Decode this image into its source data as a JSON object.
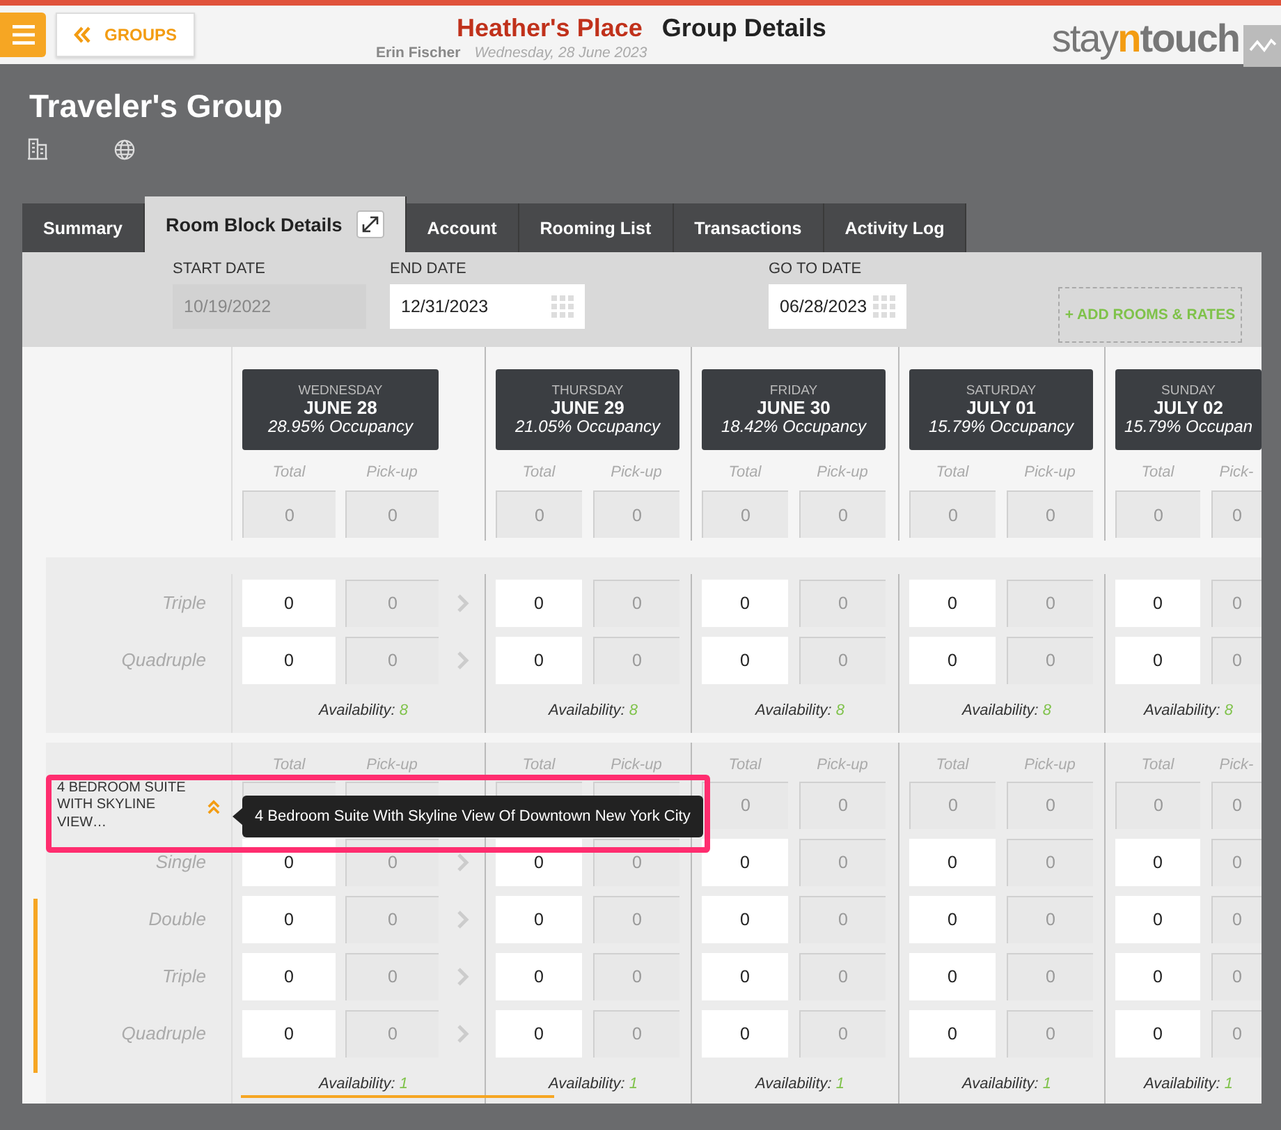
{
  "header": {
    "back_button": "GROUPS",
    "property": "Heather's Place",
    "page_title": "Group Details",
    "user": "Erin Fischer",
    "date": "Wednesday, 28 June 2023",
    "logo": [
      "stay",
      "n",
      "touch"
    ]
  },
  "group": {
    "title": "Traveler's Group"
  },
  "tabs": [
    {
      "label": "Summary",
      "selected": false
    },
    {
      "label": "Room Block Details",
      "selected": true
    },
    {
      "label": "Account",
      "selected": false
    },
    {
      "label": "Rooming List",
      "selected": false
    },
    {
      "label": "Transactions",
      "selected": false
    },
    {
      "label": "Activity Log",
      "selected": false
    }
  ],
  "dates": [
    {
      "label": "START DATE",
      "value": "10/19/2022",
      "disabled": true
    },
    {
      "label": "END DATE",
      "value": "12/31/2023",
      "disabled": false
    },
    {
      "label": "GO TO DATE",
      "value": "06/28/2023",
      "disabled": false
    }
  ],
  "add_button": "+ ADD ROOMS & RATES",
  "days": [
    {
      "weekday": "WEDNESDAY",
      "date": "JUNE 28",
      "occupancy": "28.95% Occupancy"
    },
    {
      "weekday": "THURSDAY",
      "date": "JUNE 29",
      "occupancy": "21.05% Occupancy"
    },
    {
      "weekday": "FRIDAY",
      "date": "JUNE 30",
      "occupancy": "18.42% Occupancy"
    },
    {
      "weekday": "SATURDAY",
      "date": "JULY 01",
      "occupancy": "15.79% Occupancy"
    },
    {
      "weekday": "SUNDAY",
      "date": "JULY 02",
      "occupancy": "15.79% Occupan"
    }
  ],
  "top_fields": [
    {
      "total_label": "Total",
      "pickup_label": "Pick-up",
      "total": "0",
      "pickup": "0"
    },
    {
      "total_label": "Total",
      "pickup_label": "Pick-up",
      "total": "0",
      "pickup": "0"
    },
    {
      "total_label": "Total",
      "pickup_label": "Pick-up",
      "total": "0",
      "pickup": "0"
    },
    {
      "total_label": "Total",
      "pickup_label": "Pick-up",
      "total": "0",
      "pickup": "0"
    },
    {
      "total_label": "Total",
      "pickup_label": "Pick-",
      "total": "0",
      "pickup": "0"
    }
  ],
  "room_types": [
    {
      "rows": [
        {
          "label": "Triple",
          "cells": [
            {
              "total": "0",
              "pickup": "0"
            },
            {
              "total": "0",
              "pickup": "0"
            },
            {
              "total": "0",
              "pickup": "0"
            },
            {
              "total": "0",
              "pickup": "0"
            },
            {
              "total": "0",
              "pickup": "0"
            }
          ]
        },
        {
          "label": "Quadruple",
          "cells": [
            {
              "total": "0",
              "pickup": "0"
            },
            {
              "total": "0",
              "pickup": "0"
            },
            {
              "total": "0",
              "pickup": "0"
            },
            {
              "total": "0",
              "pickup": "0"
            },
            {
              "total": "0",
              "pickup": "0"
            }
          ]
        }
      ],
      "availability": [
        {
          "label": "Availability:",
          "value": "8"
        },
        {
          "label": "Availability:",
          "value": "8"
        },
        {
          "label": "Availability:",
          "value": "8"
        },
        {
          "label": "Availability:",
          "value": "8"
        },
        {
          "label": "Availability:",
          "value": "8"
        }
      ]
    },
    {
      "name": "4 BEDROOM SUITE WITH SKYLINE VIEW…",
      "tooltip": "4 Bedroom Suite With Skyline View Of Downtown New York City",
      "column_labels": [
        {
          "total": "Total",
          "pickup": "Pick-up"
        },
        {
          "total": "Total",
          "pickup": "Pick-up"
        },
        {
          "total": "Total",
          "pickup": "Pick-up"
        },
        {
          "total": "Total",
          "pickup": "Pick-up"
        },
        {
          "total": "Total",
          "pickup": "Pick-"
        }
      ],
      "name_cells": [
        {},
        {},
        {
          "total": "0",
          "pickup": "0"
        },
        {
          "total": "0",
          "pickup": "0"
        },
        {
          "total": "0",
          "pickup": "0"
        }
      ],
      "rows": [
        {
          "label": "Single",
          "cells": [
            {
              "total": "0",
              "pickup": "0"
            },
            {
              "total": "0",
              "pickup": "0"
            },
            {
              "total": "0",
              "pickup": "0"
            },
            {
              "total": "0",
              "pickup": "0"
            },
            {
              "total": "0",
              "pickup": "0"
            }
          ]
        },
        {
          "label": "Double",
          "cells": [
            {
              "total": "0",
              "pickup": "0"
            },
            {
              "total": "0",
              "pickup": "0"
            },
            {
              "total": "0",
              "pickup": "0"
            },
            {
              "total": "0",
              "pickup": "0"
            },
            {
              "total": "0",
              "pickup": "0"
            }
          ]
        },
        {
          "label": "Triple",
          "cells": [
            {
              "total": "0",
              "pickup": "0"
            },
            {
              "total": "0",
              "pickup": "0"
            },
            {
              "total": "0",
              "pickup": "0"
            },
            {
              "total": "0",
              "pickup": "0"
            },
            {
              "total": "0",
              "pickup": "0"
            }
          ]
        },
        {
          "label": "Quadruple",
          "cells": [
            {
              "total": "0",
              "pickup": "0"
            },
            {
              "total": "0",
              "pickup": "0"
            },
            {
              "total": "0",
              "pickup": "0"
            },
            {
              "total": "0",
              "pickup": "0"
            },
            {
              "total": "0",
              "pickup": "0"
            }
          ]
        }
      ],
      "availability": [
        {
          "label": "Availability:",
          "value": "1"
        },
        {
          "label": "Availability:",
          "value": "1"
        },
        {
          "label": "Availability:",
          "value": "1"
        },
        {
          "label": "Availability:",
          "value": "1"
        },
        {
          "label": "Availability:",
          "value": "1"
        }
      ]
    }
  ]
}
